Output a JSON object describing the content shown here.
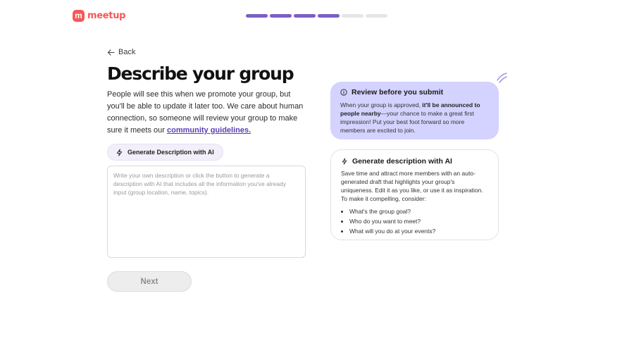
{
  "header": {
    "logo_mark": "m",
    "logo_text": "meetup",
    "progress": {
      "completed_steps": 4,
      "total_steps": 6
    }
  },
  "nav": {
    "back_label": "Back"
  },
  "main": {
    "title": "Describe your group",
    "intro_text": "People will see this when we promote your group, but you'll be able to update it later too. We care about human connection, so someone will review your group to make sure it meets our",
    "guidelines_link": "community guidelines.",
    "generate_button_label": "Generate Description with AI",
    "description_placeholder": "Write your own description or click the button to generate a description with AI that includes all the information you've already input (group location, name, topics).",
    "next_button_label": "Next"
  },
  "review_card": {
    "heading": "Review before you submit",
    "text_before": "When your group is approved, ",
    "text_bold": "it'll be announced to people nearby",
    "text_after": "—your chance to make a great first impression! Put your best foot forward so more members are excited to join."
  },
  "ai_card": {
    "heading": "Generate description with AI",
    "body": "Save time and attract more members with an auto-generated draft that highlights your group's uniqueness. Edit it as you like, or use it as inspiration. To make it compelling, consider:",
    "bullets": [
      "What's the group goal?",
      "Who do you want to meet?",
      "What will you do at your events?"
    ]
  },
  "colors": {
    "brand": "#F65858",
    "progress_done": "#7B5FC4",
    "progress_todo": "#E5E5E5",
    "link": "#5A3FB5",
    "review_bg": "#D4D2FF"
  },
  "icons": {
    "back": "arrow-left-icon",
    "generate": "lightning-icon",
    "review": "info-icon",
    "ai_card": "lightning-icon",
    "decoration": "sparkle-lines-icon"
  }
}
